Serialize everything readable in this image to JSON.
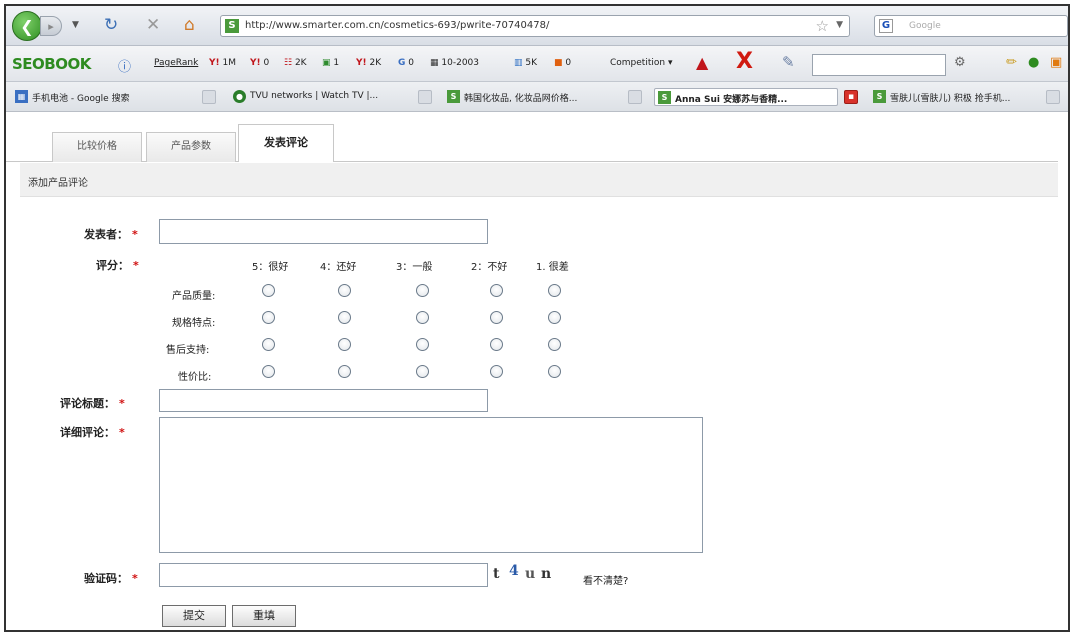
{
  "browser": {
    "url": "http://www.smarter.com.cn/cosmetics-693/pwrite-70740478/",
    "search_placeholder": "Google",
    "search_engine_glyph": "G",
    "site_glyph": "S"
  },
  "seobar": {
    "logo": "SEOBOOK",
    "pagerank": "PageRank",
    "items": [
      "1M",
      "0",
      "2K",
      "1",
      "2K",
      "0",
      "10-2003",
      "5K",
      "0"
    ],
    "competition": "Competition"
  },
  "bookmarks": [
    "手机电池 - Google 搜索",
    "TVU networks | Watch TV |...",
    "韩国化妆品, 化妆品网价格...",
    "Anna Sui 安娜苏与香精...",
    "雪肤儿(雪肤儿) 积极 抢手机..."
  ],
  "tabs": [
    "比较价格",
    "产品参数",
    "发表评论"
  ],
  "subhead": "添加产品评论",
  "form": {
    "author_label": "发表者：",
    "rating_label": "评分：",
    "required_mark": "*",
    "rating_scale": [
      "5：很好",
      "4：还好",
      "3：一般",
      "2：不好",
      "1. 很差"
    ],
    "rating_rows": [
      "产品质量:",
      "规格特点:",
      "售后支持:",
      "性价比:"
    ],
    "title_label": "评论标题：",
    "detail_label": "详细评论：",
    "captcha_label": "验证码：",
    "captcha_chars": [
      "t",
      "4",
      "u",
      "n"
    ],
    "captcha_help": "看不清楚?",
    "submit": "提交",
    "reset": "重填"
  }
}
